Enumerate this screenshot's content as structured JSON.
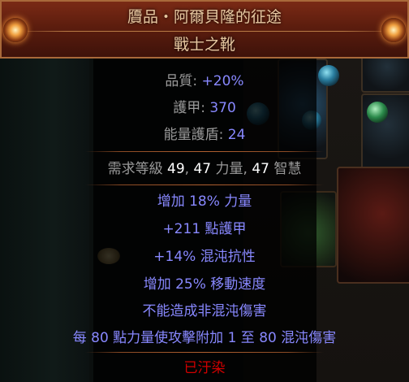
{
  "item": {
    "name": "贗品・阿爾貝隆的征途",
    "base_type": "戰士之靴",
    "properties": [
      {
        "label": "品質: ",
        "value": "+20%"
      },
      {
        "label": "護甲: ",
        "value": "370"
      },
      {
        "label": "能量護盾: ",
        "value": "24"
      }
    ],
    "requirements": {
      "prefix": "需求等級 ",
      "level": "49",
      "sep1": ", ",
      "str": "47",
      "str_label": " 力量",
      "sep2": ", ",
      "int": "47",
      "int_label": " 智慧"
    },
    "modifiers": [
      "增加 18% 力量",
      "+211 點護甲",
      "+14% 混沌抗性",
      "增加 25% 移動速度",
      "不能造成非混沌傷害",
      "每 80 點力量使攻擊附加 1 至 80 混沌傷害"
    ],
    "corrupted": "已汙染"
  },
  "colors": {
    "header_bg": "#5c1d0e",
    "header_border": "#a9693a",
    "title_text": "#e6c7a0",
    "magic_blue": "#8888ff",
    "label_grey": "#9a9a9a",
    "corrupted_red": "#d20000"
  },
  "icons": {
    "header_left": "ornament-orb-icon",
    "header_right": "ornament-orb-icon"
  }
}
